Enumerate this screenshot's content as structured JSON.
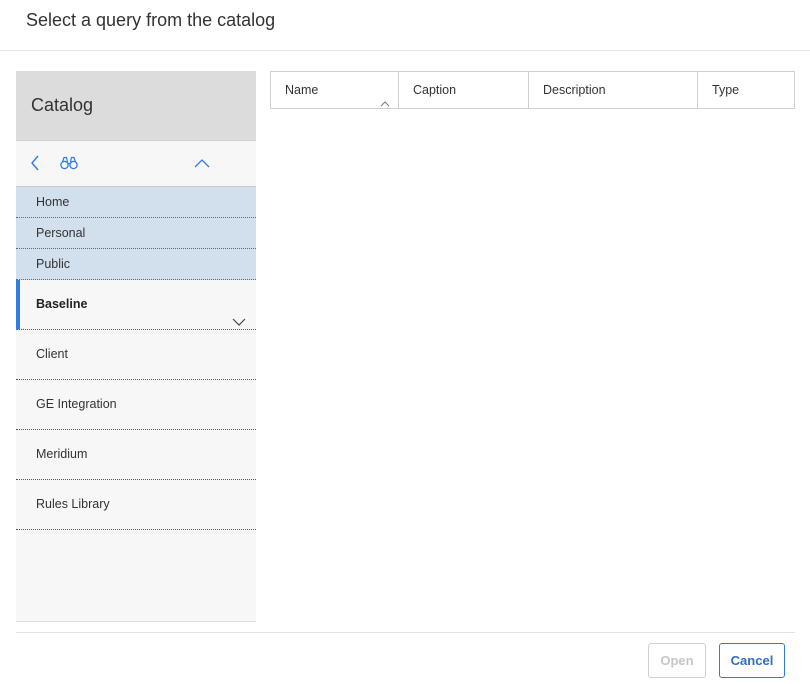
{
  "dialog": {
    "title": "Select a query from the catalog"
  },
  "catalog": {
    "title": "Catalog",
    "toolbar": {
      "back_icon": "chevron-left-icon",
      "search_icon": "binoculars-icon",
      "collapse_icon": "chevron-up-icon"
    },
    "path_items": [
      {
        "label": "Home"
      },
      {
        "label": "Personal"
      },
      {
        "label": "Public"
      }
    ],
    "folders": [
      {
        "label": "Baseline",
        "active": true
      },
      {
        "label": "Client"
      },
      {
        "label": "GE Integration"
      },
      {
        "label": "Meridium"
      },
      {
        "label": "Rules Library"
      }
    ]
  },
  "table": {
    "columns": [
      {
        "label": "Name",
        "sorted": "ascending"
      },
      {
        "label": "Caption"
      },
      {
        "label": "Description"
      },
      {
        "label": "Type"
      }
    ]
  },
  "footer": {
    "open_label": "Open",
    "open_disabled": true,
    "cancel_label": "Cancel"
  },
  "colors": {
    "accent": "#2f7de1",
    "path_bg": "#d2dfed",
    "catalog_header_bg": "#dcdcdc",
    "panel_bg": "#f7f7f7"
  }
}
